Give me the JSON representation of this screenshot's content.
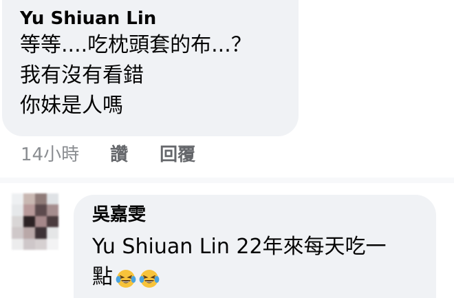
{
  "comment": {
    "author": "Yu Shiuan Lin",
    "lines": [
      "等等....吃枕頭套的布...？",
      "我有沒有看錯",
      "你妹是人嗎"
    ],
    "timestamp": "14小時",
    "like_label": "讚",
    "reply_label": "回覆"
  },
  "reply": {
    "author": "吳嘉雯",
    "mention": "Yu Shiuan Lin",
    "text_line1": " 22年來每天吃一",
    "text_line2": "點",
    "emoji_name": "laughing-tears-icon",
    "emoji_count": 2
  },
  "colors": {
    "bubble": "#f0f2f5",
    "text": "#050505",
    "meta": "#65676b",
    "emoji_face": "#f7c33b",
    "emoji_tear": "#4aa3df"
  }
}
